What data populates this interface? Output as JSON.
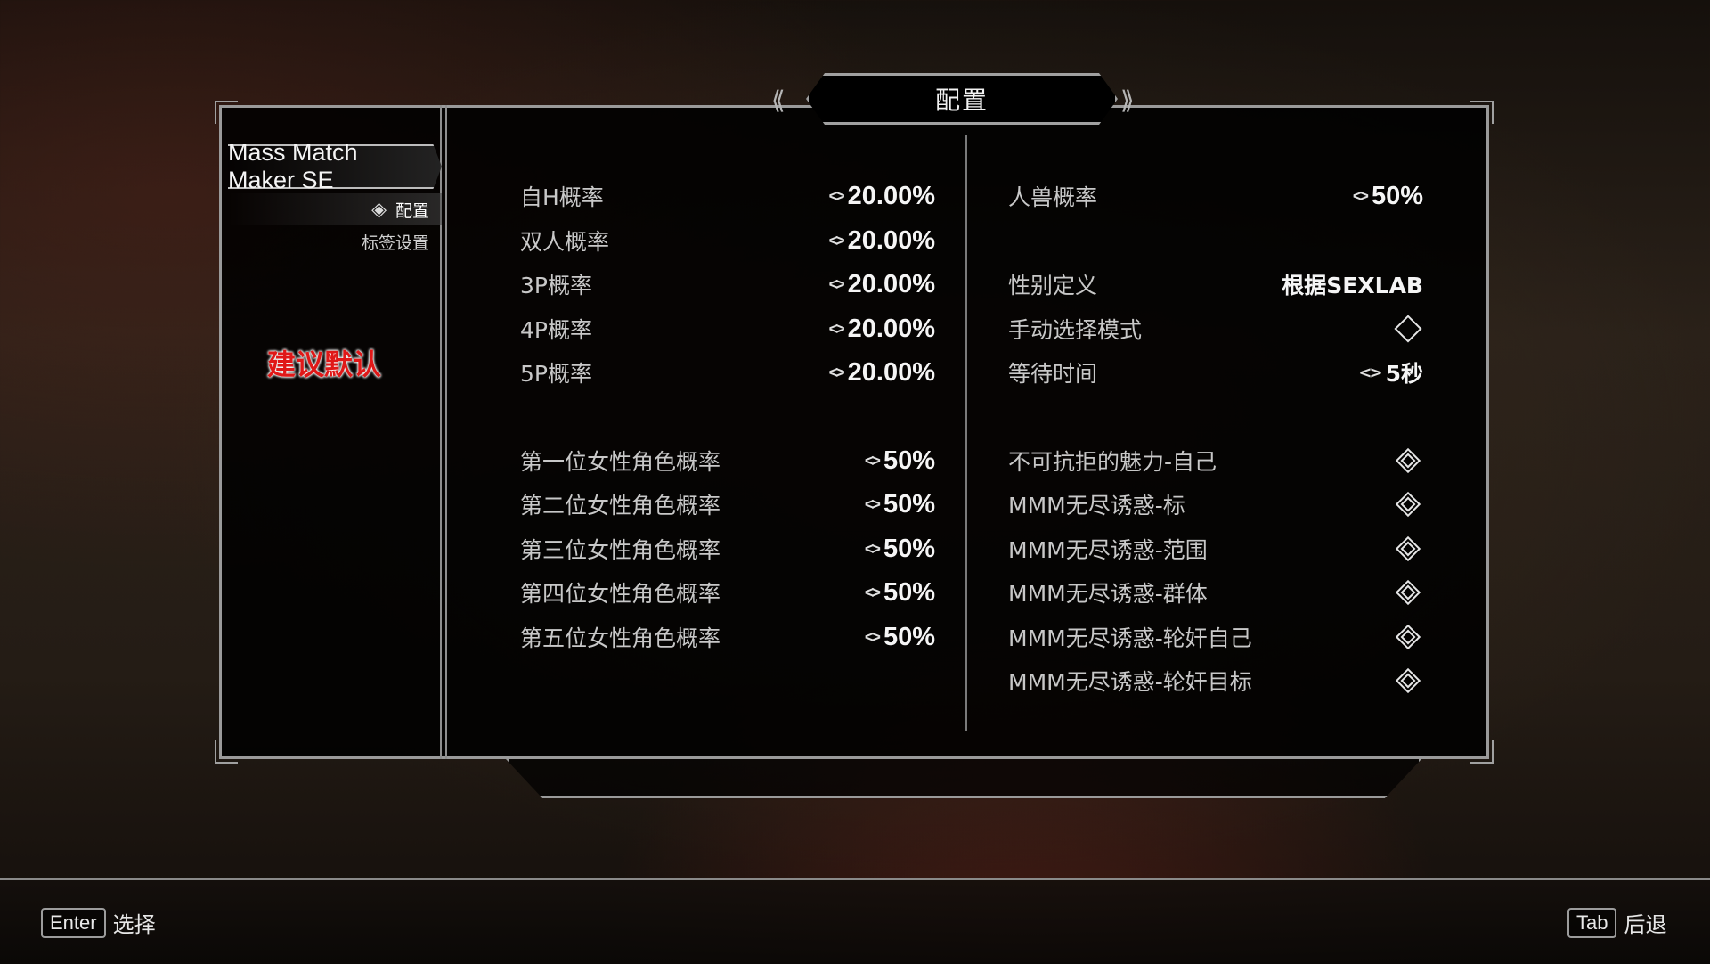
{
  "header": {
    "title": "配置"
  },
  "sidebar": {
    "mod_title": "Mass Match Maker SE",
    "pages": [
      {
        "label": "配置",
        "active": true
      },
      {
        "label": "标签设置",
        "active": false
      }
    ],
    "annotation": "建议默认"
  },
  "settings": {
    "left": [
      {
        "label": "自H概率",
        "value": "20.00%"
      },
      {
        "label": "双人概率",
        "value": "20.00%"
      },
      {
        "label": "3P概率",
        "value": "20.00%"
      },
      {
        "label": "4P概率",
        "value": "20.00%"
      },
      {
        "label": "5P概率",
        "value": "20.00%"
      },
      {
        "label": "第一位女性角色概率",
        "value": "50%"
      },
      {
        "label": "第二位女性角色概率",
        "value": "50%"
      },
      {
        "label": "第三位女性角色概率",
        "value": "50%"
      },
      {
        "label": "第四位女性角色概率",
        "value": "50%"
      },
      {
        "label": "第五位女性角色概率",
        "value": "50%"
      }
    ],
    "right": [
      {
        "label": "人兽概率",
        "value": "50%",
        "type": "slider"
      },
      {
        "label": "性别定义",
        "value": "根据SEXLAB",
        "type": "menu"
      },
      {
        "label": "手动选择模式",
        "value": false,
        "type": "toggle"
      },
      {
        "label": "等待时间",
        "value": "5秒",
        "type": "slider"
      },
      {
        "label": "不可抗拒的魅力-自己",
        "value": true,
        "type": "toggle"
      },
      {
        "label": "MMM无尽诱惑-标",
        "value": true,
        "type": "toggle"
      },
      {
        "label": "MMM无尽诱惑-范围",
        "value": true,
        "type": "toggle"
      },
      {
        "label": "MMM无尽诱惑-群体",
        "value": true,
        "type": "toggle"
      },
      {
        "label": "MMM无尽诱惑-轮奸自己",
        "value": true,
        "type": "toggle"
      },
      {
        "label": "MMM无尽诱惑-轮奸目标",
        "value": true,
        "type": "toggle"
      }
    ]
  },
  "footer": {
    "select": {
      "key": "Enter",
      "label": "选择"
    },
    "back": {
      "key": "Tab",
      "label": "后退"
    }
  },
  "icons": {
    "slider": "slider-arrows-icon",
    "toggle_on": "toggle-checked-icon",
    "toggle_off": "toggle-unchecked-icon",
    "selected_page": "selected-page-icon"
  }
}
